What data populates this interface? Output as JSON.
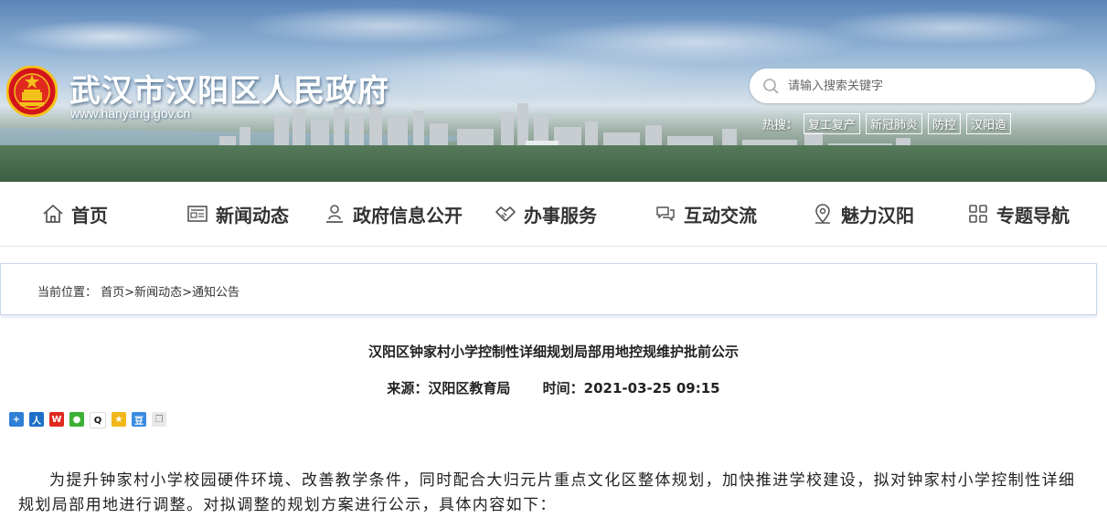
{
  "header": {
    "site_title": "武汉市汉阳区人民政府",
    "site_url": "www.hanyang.gov.cn",
    "search_placeholder": "请输入搜索关键字",
    "hot_label": "热搜：",
    "hot_tags": [
      "复工复产",
      "新冠肺炎",
      "防控",
      "汉阳造"
    ]
  },
  "nav": {
    "items": [
      {
        "label": "首页",
        "icon": "home-icon"
      },
      {
        "label": "新闻动态",
        "icon": "newspaper-icon"
      },
      {
        "label": "政府信息公开",
        "icon": "person-podium-icon"
      },
      {
        "label": "办事服务",
        "icon": "handshake-icon"
      },
      {
        "label": "互动交流",
        "icon": "chat-bubbles-icon"
      },
      {
        "label": "魅力汉阳",
        "icon": "location-pin-icon"
      },
      {
        "label": "专题导航",
        "icon": "grid-apps-icon"
      }
    ]
  },
  "breadcrumb": {
    "label": "当前位置：",
    "items": [
      "首页",
      "新闻动态",
      "通知公告"
    ],
    "separator": ">"
  },
  "article": {
    "title": "汉阳区钟家村小学控制性详细规划局部用地控规维护批前公示",
    "source_label": "来源：",
    "source": "汉阳区教育局",
    "time_label": "时间：",
    "time": "2021-03-25 09:15",
    "body": "为提升钟家村小学校园硬件环境、改善教学条件，同时配合大归元片重点文化区整体规划，加快推进学校建设，拟对钟家村小学控制性详细规划局部用地进行调整。对拟调整的规划方案进行公示，具体内容如下："
  },
  "share_icons": [
    "plus-share-icon",
    "renren-icon",
    "weibo-icon",
    "wechat-icon",
    "qq-icon",
    "qzone-icon",
    "douban-icon",
    "copy-icon"
  ],
  "colors": {
    "nav_text": "#333333",
    "banner_sky": "#5b86b8",
    "border_accent": "#c9d7e8"
  }
}
